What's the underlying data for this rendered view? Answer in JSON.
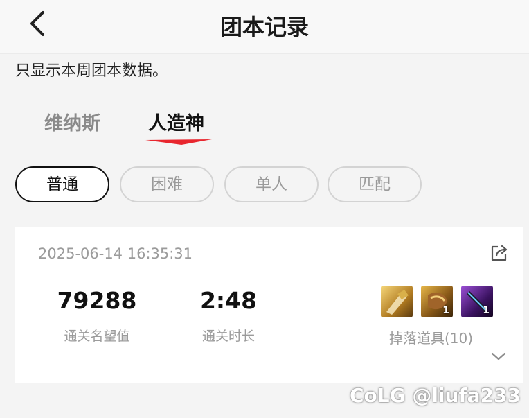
{
  "header": {
    "title": "团本记录",
    "back_icon": "chevron-left-icon"
  },
  "note": "只显示本周团本数据。",
  "tabs": [
    {
      "label": "维纳斯",
      "active": false
    },
    {
      "label": "人造神",
      "active": true
    }
  ],
  "accent_color": "#e8262e",
  "difficulty": [
    {
      "label": "普通",
      "active": true
    },
    {
      "label": "困难",
      "active": false
    },
    {
      "label": "单人",
      "active": false
    },
    {
      "label": "匹配",
      "active": false
    }
  ],
  "record": {
    "timestamp": "2025-06-14 16:35:31",
    "share_icon": "share-icon",
    "fame_value": "79288",
    "fame_label": "通关名望值",
    "duration_value": "2:48",
    "duration_label": "通关时长",
    "items": [
      {
        "icon": "gold-armor-icon",
        "count": ""
      },
      {
        "icon": "gold-bracer-icon",
        "count": "1"
      },
      {
        "icon": "purple-weapon-icon",
        "count": "1"
      }
    ],
    "drops_label": "掉落道具(10)",
    "expand_icon": "chevron-down-icon"
  },
  "watermark": "CoLG @liufa233"
}
